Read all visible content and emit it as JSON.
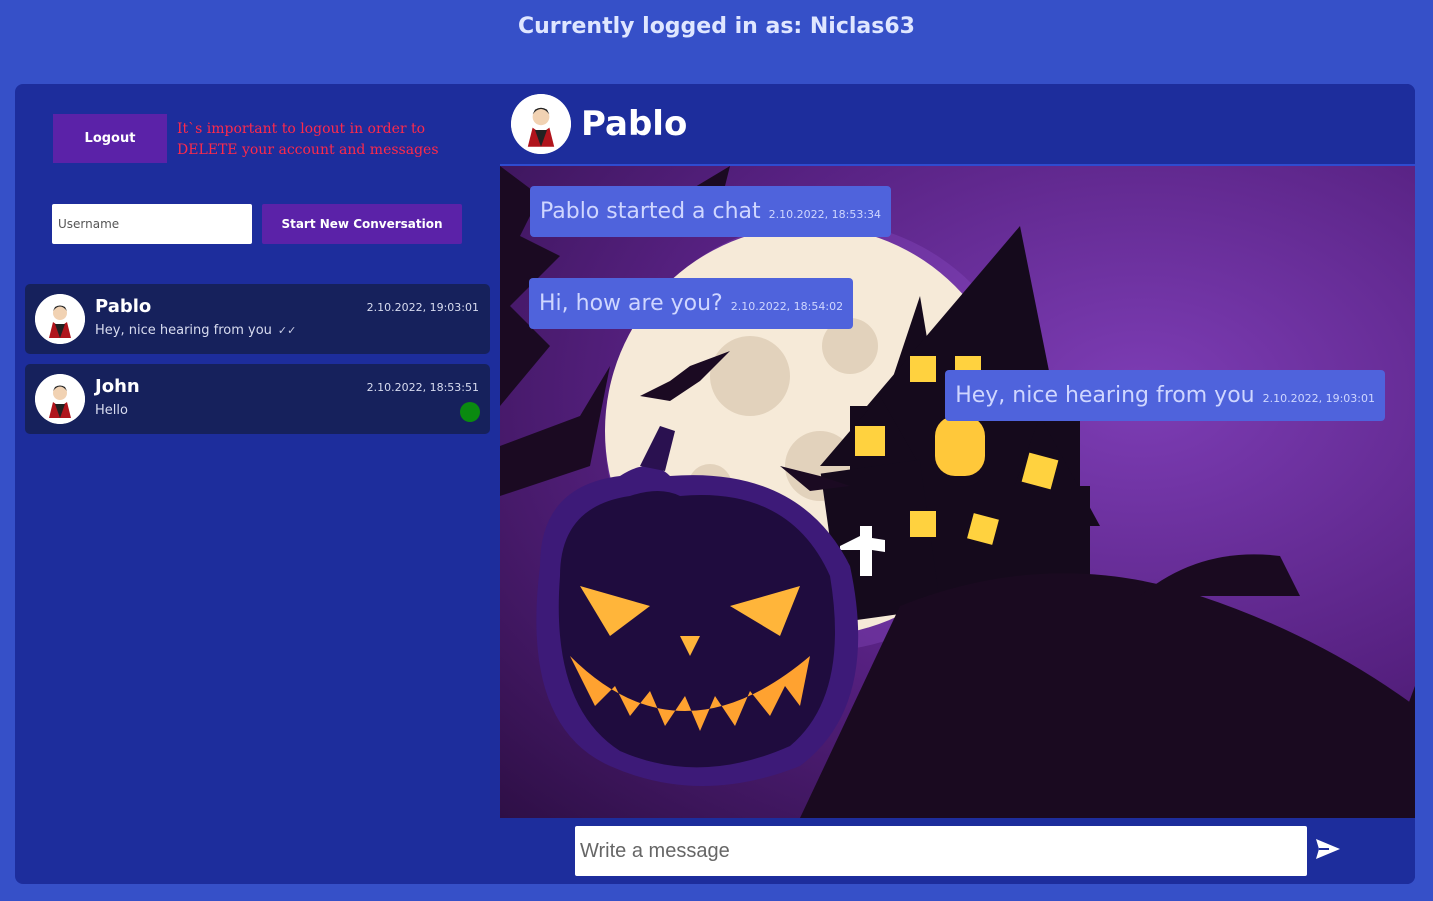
{
  "header": {
    "logged_in": "Currently logged in as: Niclas63"
  },
  "sidebar": {
    "logout_label": "Logout",
    "warning": "It`s important to logout in order to DELETE your account and messages",
    "username_placeholder": "Username",
    "start_label": "Start New Conversation",
    "conversations": [
      {
        "name": "Pablo",
        "last_message": "Hey, nice hearing from you",
        "time": "2.10.2022, 19:03:01",
        "read_icon": "double-check-icon"
      },
      {
        "name": "John",
        "last_message": "Hello",
        "time": "2.10.2022, 18:53:51",
        "status": "online"
      }
    ]
  },
  "chat": {
    "name": "Pablo",
    "messages": [
      {
        "text": "Pablo started a chat",
        "time": "2.10.2022, 18:53:34",
        "side": "left"
      },
      {
        "text": "Hi, how are you?",
        "time": "2.10.2022, 18:54:02",
        "side": "left"
      },
      {
        "text": "Hey, nice hearing from you",
        "time": "2.10.2022, 19:03:01",
        "side": "right"
      }
    ],
    "input_placeholder": "Write a message",
    "send_icon": "send-icon"
  },
  "colors": {
    "page_bg": "#3650c8",
    "panel_bg": "#1d2d9c",
    "button": "#5b22a8",
    "warning": "#ff2a4a",
    "bubble": "#4f63dc",
    "online": "#0a8a10"
  }
}
